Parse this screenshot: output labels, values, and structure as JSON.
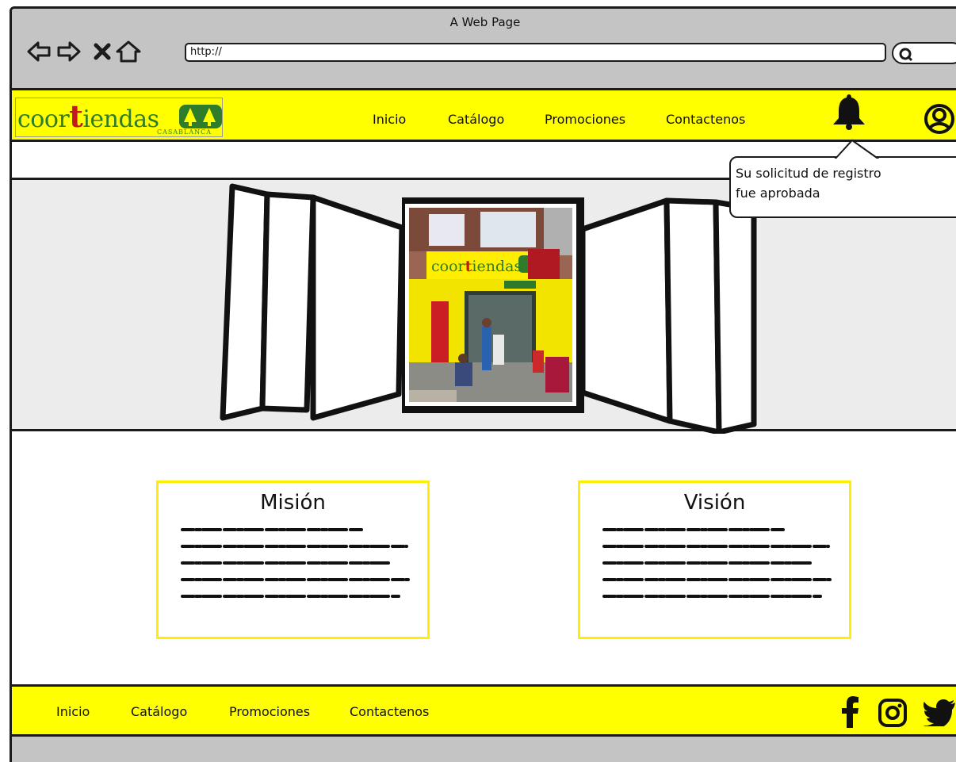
{
  "window": {
    "title": "A Web Page"
  },
  "browser": {
    "url": "http://",
    "icons": [
      "back-arrow-icon",
      "forward-arrow-icon",
      "close-icon",
      "home-icon",
      "search-icon"
    ]
  },
  "header": {
    "logo": {
      "main_before": "coor",
      "main_t": "t",
      "main_after": "iendas",
      "sub": "CASABLANCA"
    },
    "nav": [
      "Inicio",
      "Catálogo",
      "Promociones",
      "Contactenos"
    ],
    "icons": [
      "bell-icon",
      "user-icon"
    ]
  },
  "notification": {
    "line1": "Su solicitud de registro",
    "line2": "fue aprobada"
  },
  "cards": {
    "mission": {
      "title": "Misión"
    },
    "vision": {
      "title": "Visión"
    }
  },
  "footer": {
    "nav": [
      "Inicio",
      "Catálogo",
      "Promociones",
      "Contactenos"
    ],
    "social_icons": [
      "facebook-icon",
      "instagram-icon",
      "twitter-icon"
    ]
  },
  "colors": {
    "brand_yellow": "#ffff00",
    "brand_green": "#2f7d2a",
    "brand_red": "#c1191d",
    "chrome_gray": "#c4c4c4"
  }
}
